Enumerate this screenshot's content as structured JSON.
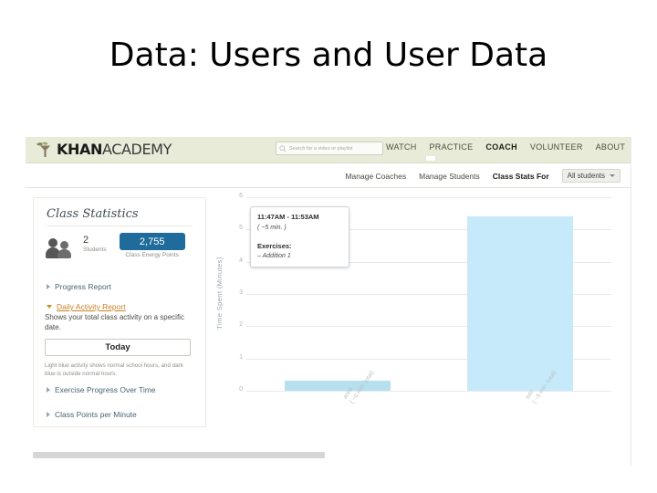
{
  "slide": {
    "title": "Data: Users and User Data"
  },
  "site_header": {
    "logo_text_bold": "KHAN",
    "logo_text_light": "ACADEMY",
    "logo_icon": "leaf-icon",
    "search": {
      "placeholder": "Search for a video or playlist",
      "value": "",
      "icon": "search-icon"
    },
    "nav": [
      {
        "label": "WATCH",
        "active": false
      },
      {
        "label": "PRACTICE",
        "active": false
      },
      {
        "label": "COACH",
        "active": true
      },
      {
        "label": "VOLUNTEER",
        "active": false
      },
      {
        "label": "ABOUT",
        "active": false
      }
    ],
    "background_color": "#e9ebd9"
  },
  "subnav": {
    "links": [
      {
        "label": "Manage Coaches"
      },
      {
        "label": "Manage Students"
      }
    ],
    "stats_label": "Class Stats For",
    "student_filter": {
      "selected": "All students",
      "icon": "chevron-down-icon"
    }
  },
  "sidebar": {
    "title": "Class Statistics",
    "students": {
      "count": "2",
      "caption": "Students",
      "icon": "students-icon"
    },
    "energy_points": {
      "value": "2,755",
      "caption": "Class Energy Points",
      "badge_color": "#1f6b9b"
    },
    "reports": [
      {
        "label": "Progress Report",
        "expanded": false,
        "highlighted": false
      },
      {
        "label": "Daily Activity Report",
        "expanded": true,
        "highlighted": true
      },
      {
        "label": "Exercise Progress Over Time",
        "expanded": false,
        "highlighted": false
      },
      {
        "label": "Class Points per Minute",
        "expanded": false,
        "highlighted": false
      }
    ],
    "daily_activity": {
      "description": "Shows your total class activity on a specific date.",
      "button_label": "Today",
      "note": "Light blue activity shows normal school hours, and dark blue is outside normal hours."
    }
  },
  "tooltip": {
    "time_range": "11:47AM  -  11:53AM",
    "duration": "( ~5 min. )",
    "exercises_label": "Exercises:",
    "exercises": [
      "–  Addition 1"
    ]
  },
  "chart_data": {
    "type": "bar",
    "title": "",
    "xlabel": "",
    "ylabel": "Time Spent (Minutes)",
    "categories": [
      "anita",
      "toto"
    ],
    "category_sublabels": [
      "( ~0 min. total)",
      "( ~5 min. total)"
    ],
    "values": [
      0.3,
      5.4
    ],
    "ylim": [
      0,
      6
    ],
    "yticks": [
      "0",
      "1",
      "2",
      "3",
      "4",
      "5",
      "6"
    ],
    "grid": true,
    "legend": "none",
    "bar_colors": [
      "#b6e0ee",
      "#c6eafa"
    ]
  },
  "scrollbar": {
    "orientation": "horizontal"
  }
}
